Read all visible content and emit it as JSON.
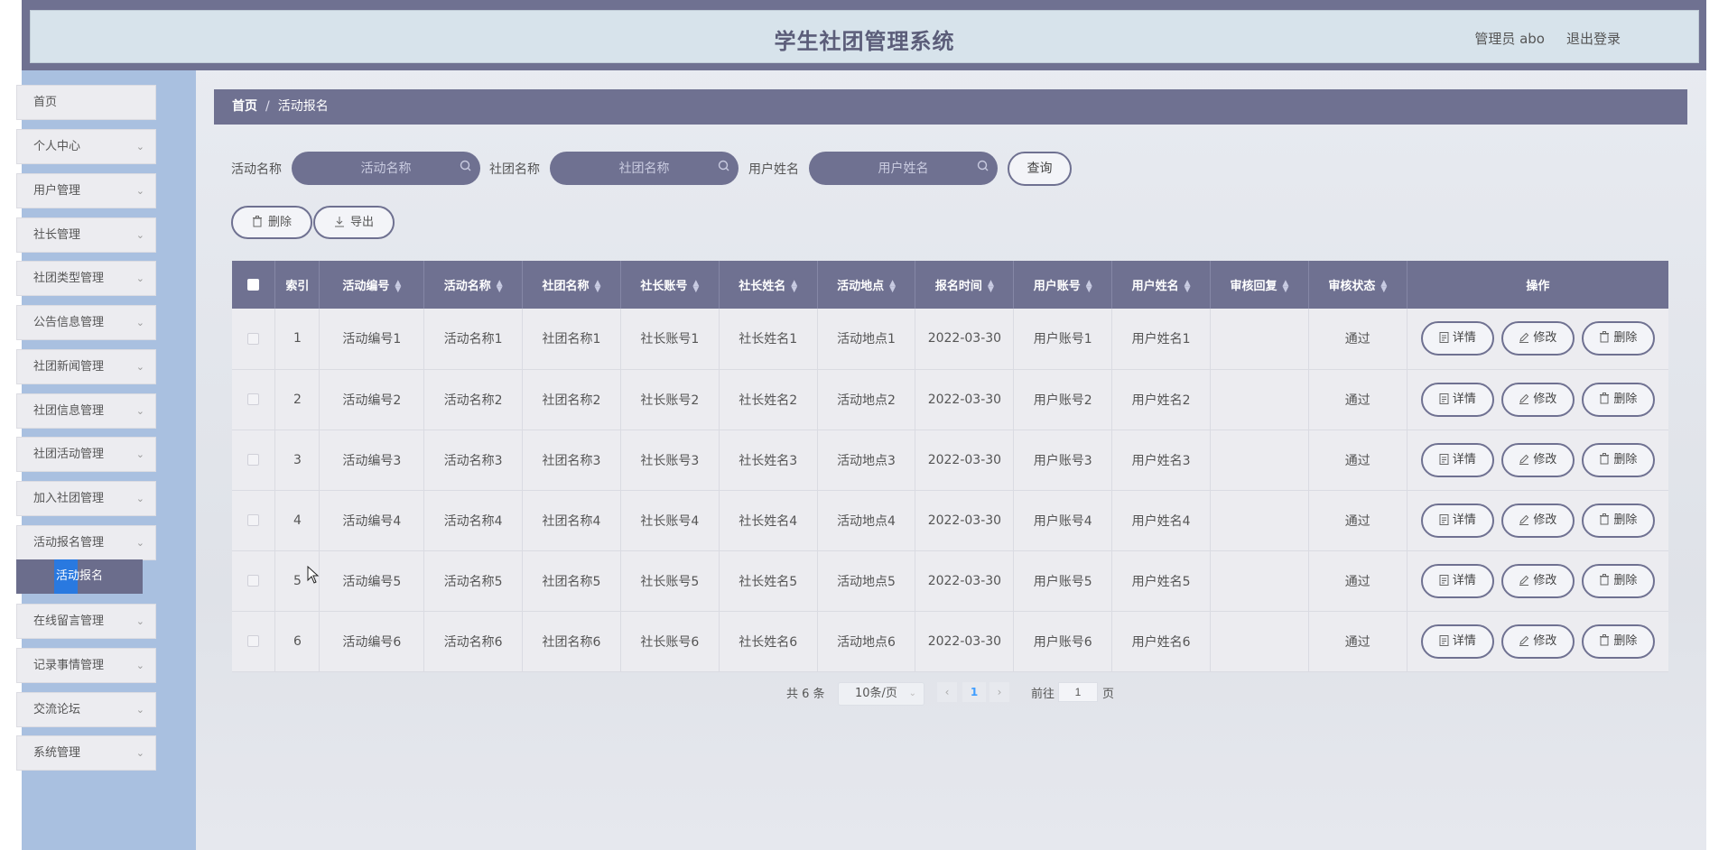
{
  "header": {
    "title": "学生社团管理系统",
    "user": "管理员 abo",
    "logout": "退出登录"
  },
  "sidebar": {
    "items": [
      {
        "label": "首页",
        "has_children": false
      },
      {
        "label": "个人中心",
        "has_children": true
      },
      {
        "label": "用户管理",
        "has_children": true
      },
      {
        "label": "社长管理",
        "has_children": true
      },
      {
        "label": "社团类型管理",
        "has_children": true
      },
      {
        "label": "公告信息管理",
        "has_children": true
      },
      {
        "label": "社团新闻管理",
        "has_children": true
      },
      {
        "label": "社团信息管理",
        "has_children": true
      },
      {
        "label": "社团活动管理",
        "has_children": true
      },
      {
        "label": "加入社团管理",
        "has_children": true
      },
      {
        "label": "活动报名管理",
        "has_children": true
      },
      {
        "label": "在线留言管理",
        "has_children": true
      },
      {
        "label": "记录事情管理",
        "has_children": true
      },
      {
        "label": "交流论坛",
        "has_children": true
      },
      {
        "label": "系统管理",
        "has_children": true
      }
    ],
    "active_submenu": "活动报名"
  },
  "breadcrumb": {
    "home": "首页",
    "separator": "/",
    "current": "活动报名"
  },
  "search": {
    "fields": [
      {
        "label": "活动名称",
        "placeholder": "活动名称",
        "value": ""
      },
      {
        "label": "社团名称",
        "placeholder": "社团名称",
        "value": ""
      },
      {
        "label": "用户姓名",
        "placeholder": "用户姓名",
        "value": ""
      }
    ],
    "query_button": "查询"
  },
  "toolbar": {
    "delete": "删除",
    "export": "导出"
  },
  "table": {
    "columns": [
      "索引",
      "活动编号",
      "活动名称",
      "社团名称",
      "社长账号",
      "社长姓名",
      "活动地点",
      "报名时间",
      "用户账号",
      "用户姓名",
      "审核回复",
      "审核状态",
      "操作"
    ],
    "rows": [
      {
        "index": "1",
        "cells": [
          "活动编号1",
          "活动名称1",
          "社团名称1",
          "社长账号1",
          "社长姓名1",
          "活动地点1",
          "2022-03-30",
          "用户账号1",
          "用户姓名1",
          "",
          "通过"
        ]
      },
      {
        "index": "2",
        "cells": [
          "活动编号2",
          "活动名称2",
          "社团名称2",
          "社长账号2",
          "社长姓名2",
          "活动地点2",
          "2022-03-30",
          "用户账号2",
          "用户姓名2",
          "",
          "通过"
        ]
      },
      {
        "index": "3",
        "cells": [
          "活动编号3",
          "活动名称3",
          "社团名称3",
          "社长账号3",
          "社长姓名3",
          "活动地点3",
          "2022-03-30",
          "用户账号3",
          "用户姓名3",
          "",
          "通过"
        ]
      },
      {
        "index": "4",
        "cells": [
          "活动编号4",
          "活动名称4",
          "社团名称4",
          "社长账号4",
          "社长姓名4",
          "活动地点4",
          "2022-03-30",
          "用户账号4",
          "用户姓名4",
          "",
          "通过"
        ]
      },
      {
        "index": "5",
        "cells": [
          "活动编号5",
          "活动名称5",
          "社团名称5",
          "社长账号5",
          "社长姓名5",
          "活动地点5",
          "2022-03-30",
          "用户账号5",
          "用户姓名5",
          "",
          "通过"
        ]
      },
      {
        "index": "6",
        "cells": [
          "活动编号6",
          "活动名称6",
          "社团名称6",
          "社长账号6",
          "社长姓名6",
          "活动地点6",
          "2022-03-30",
          "用户账号6",
          "用户姓名6",
          "",
          "通过"
        ]
      }
    ],
    "row_actions": {
      "detail": "详情",
      "edit": "修改",
      "delete": "删除"
    }
  },
  "pagination": {
    "total_text": "共 6 条",
    "page_size": "10条/页",
    "prev_icon": "‹",
    "current_page": "1",
    "next_icon": "›",
    "goto_label": "前往",
    "goto_value": "1",
    "goto_unit": "页"
  }
}
